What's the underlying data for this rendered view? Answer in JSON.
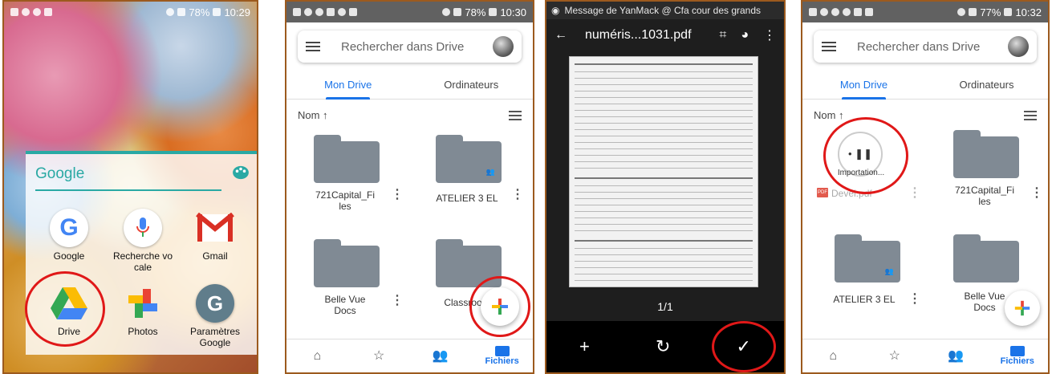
{
  "panel1": {
    "status": {
      "battery": "78%",
      "time": "10:29"
    },
    "folder_title": "Google",
    "apps": [
      {
        "label": "Google"
      },
      {
        "label": "Recherche vo\ncale"
      },
      {
        "label": "Gmail"
      },
      {
        "label": "Drive"
      },
      {
        "label": "Photos"
      },
      {
        "label": "Paramètres\nGoogle"
      }
    ],
    "icons": [
      "google-icon",
      "mic-icon",
      "gmail-icon",
      "drive-icon",
      "photos-icon",
      "settings-icon"
    ]
  },
  "panel2": {
    "status": {
      "battery": "78%",
      "time": "10:30"
    },
    "search_placeholder": "Rechercher dans Drive",
    "tabs": [
      "Mon Drive",
      "Ordinateurs"
    ],
    "sort_label": "Nom ↑",
    "files": [
      {
        "name": "721Capital_Fi\nles"
      },
      {
        "name": "ATELIER 3 EL"
      },
      {
        "name": "Belle Vue\nDocs"
      },
      {
        "name": "Classroom"
      }
    ],
    "nav": [
      {
        "label": ""
      },
      {
        "label": ""
      },
      {
        "label": ""
      },
      {
        "label": "Fichiers"
      }
    ]
  },
  "panel3": {
    "notification": "Message de YanMack @ Cfa cour des grands",
    "title": "numéris...1031.pdf",
    "page_indicator": "1/1"
  },
  "panel4": {
    "status": {
      "battery": "77%",
      "time": "10:32"
    },
    "search_placeholder": "Rechercher dans Drive",
    "tabs": [
      "Mon Drive",
      "Ordinateurs"
    ],
    "sort_label": "Nom ↑",
    "upload_label": "Importation...",
    "files": [
      {
        "name": "Devel.pdf"
      },
      {
        "name": "721Capital_Fi\nles"
      },
      {
        "name": "ATELIER 3 EL"
      },
      {
        "name": "Belle Vue\nDocs"
      }
    ],
    "nav": [
      {
        "label": ""
      },
      {
        "label": ""
      },
      {
        "label": ""
      },
      {
        "label": "Fichiers"
      }
    ]
  },
  "colors": {
    "drive_blue": "#1a73e8",
    "highlight_red": "#e01818",
    "teal": "#2aa9a4"
  }
}
